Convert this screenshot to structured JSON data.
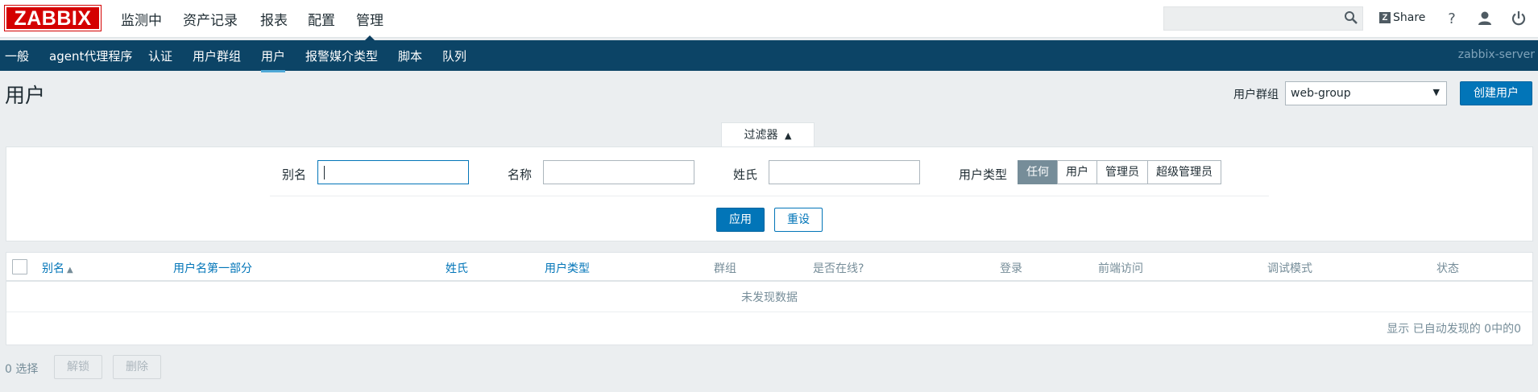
{
  "header": {
    "logo": "ZABBIX",
    "nav": [
      "监测中",
      "资产记录",
      "报表",
      "配置",
      "管理"
    ],
    "active_nav_index": 4,
    "share_label": "Share",
    "help_label": "?"
  },
  "subnav": {
    "items": [
      "一般",
      "agent代理程序",
      "认证",
      "用户群组",
      "用户",
      "报警媒介类型",
      "脚本",
      "队列"
    ],
    "active_index": 4,
    "server": "zabbix-server"
  },
  "page": {
    "title": "用户",
    "usergroup_label": "用户群组",
    "usergroup_value": "web-group",
    "create_label": "创建用户"
  },
  "filter": {
    "tab_label": "过滤器",
    "tab_arrow": "▲",
    "alias_label": "别名",
    "alias_value": "",
    "name_label": "名称",
    "name_value": "",
    "surname_label": "姓氏",
    "surname_value": "",
    "type_label": "用户类型",
    "type_options": [
      "任何",
      "用户",
      "管理员",
      "超级管理员"
    ],
    "type_selected": "任何",
    "apply_label": "应用",
    "reset_label": "重设"
  },
  "table": {
    "columns": [
      "别名",
      "用户名第一部分",
      "姓氏",
      "用户类型",
      "群组",
      "是否在线?",
      "登录",
      "前端访问",
      "调试模式",
      "状态"
    ],
    "sorted_column": "别名",
    "sort_direction": "asc",
    "empty_text": "未发现数据",
    "footer": "显示 已自动发现的 0中的0"
  },
  "actions": {
    "selected": "0 选择",
    "unblock_label": "解锁",
    "delete_label": "删除"
  },
  "colors": {
    "brand_red": "#d40000",
    "nav_dark": "#0c4466",
    "accent_blue": "#0275b8",
    "selected_segment": "#768d99"
  }
}
